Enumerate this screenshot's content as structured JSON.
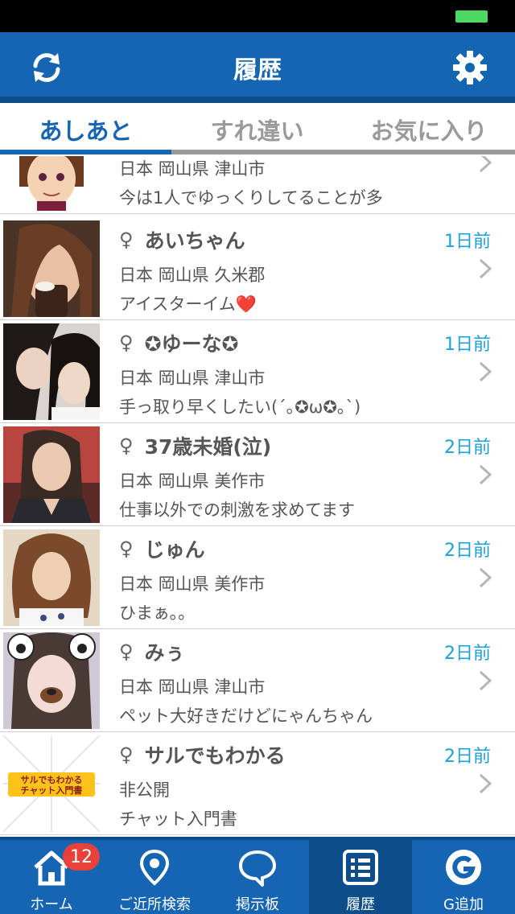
{
  "header": {
    "title": "履歴",
    "left_icon": "refresh-icon",
    "right_icon": "gear-icon"
  },
  "tabs": [
    {
      "label": "あしあと",
      "active": true
    },
    {
      "label": "すれ違い",
      "active": false
    },
    {
      "label": "お気に入り",
      "active": false
    }
  ],
  "list": [
    {
      "name": "",
      "gender": "",
      "time": "",
      "location": "日本 岡山県 津山市",
      "message": "今は1人でゆっくりしてることが多"
    },
    {
      "name": "あいちゃん",
      "gender": "♀",
      "time": "1日前",
      "location": "日本 岡山県 久米郡",
      "message": "アイスターイム❤️"
    },
    {
      "name": "✪ゆーな✪",
      "gender": "♀",
      "time": "1日前",
      "location": "日本 岡山県 津山市",
      "message": "手っ取り早くしたい(´｡✪ω✪｡`)"
    },
    {
      "name": "37歳未婚(泣)",
      "gender": "♀",
      "time": "2日前",
      "location": "日本 岡山県 美作市",
      "message": "仕事以外での刺激を求めてます"
    },
    {
      "name": "じゅん",
      "gender": "♀",
      "time": "2日前",
      "location": "日本 岡山県 美作市",
      "message": "ひまぁ。。"
    },
    {
      "name": "みぅ",
      "gender": "♀",
      "time": "2日前",
      "location": "日本 岡山県 津山市",
      "message": "ペット大好きだけどにゃんちゃん"
    },
    {
      "name": "サルでもわかる",
      "gender": "♀",
      "time": "2日前",
      "location": "非公開",
      "message": "チャット入門書",
      "avatar_text": [
        "サルでもわかる",
        "チャット入門書"
      ]
    }
  ],
  "tabbar": [
    {
      "label": "ホーム",
      "icon": "home-icon",
      "badge": "12",
      "active": false
    },
    {
      "label": "ご近所検索",
      "icon": "location-pin-icon",
      "active": false
    },
    {
      "label": "掲示板",
      "icon": "chat-bubble-icon",
      "active": false
    },
    {
      "label": "履歴",
      "icon": "history-list-icon",
      "active": true
    },
    {
      "label": "G追加",
      "icon": "g-add-icon",
      "active": false
    }
  ],
  "colors": {
    "primary": "#1565b3",
    "primary_dark": "#0d4d8a",
    "time_text": "#1e9fd8",
    "badge": "#e8403a"
  }
}
